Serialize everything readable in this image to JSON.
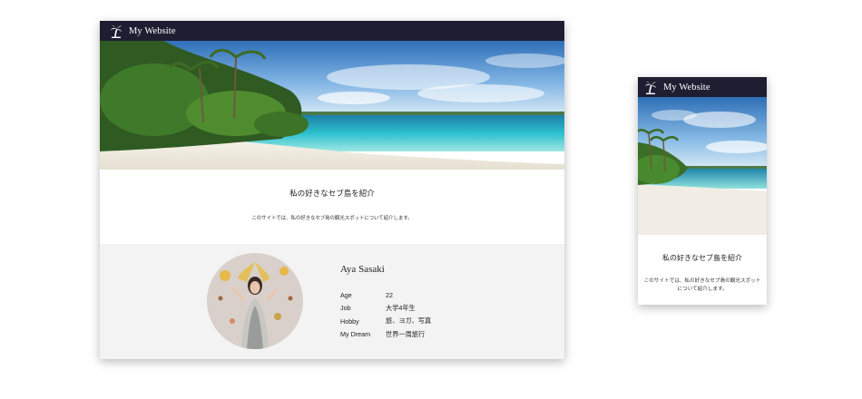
{
  "site": {
    "name": "My Website",
    "icon": "palm-tree-icon"
  },
  "intro": {
    "title": "私の好きなセブ島を紹介",
    "text": "このサイトでは、私の好きなセブ島の観光スポットについて紹介します。"
  },
  "profile": {
    "name": "Aya Sasaki",
    "rows": [
      {
        "key": "Age",
        "value": "22"
      },
      {
        "key": "Job",
        "value": "大学4年生"
      },
      {
        "key": "Hobby",
        "value": "旅、ヨガ、写真"
      },
      {
        "key": "My Dream",
        "value": "世界一周旅行"
      }
    ]
  },
  "colors": {
    "navbar": "#1e1e33",
    "profile_background": "#f3f3f3",
    "page_background": "#ffffff"
  }
}
